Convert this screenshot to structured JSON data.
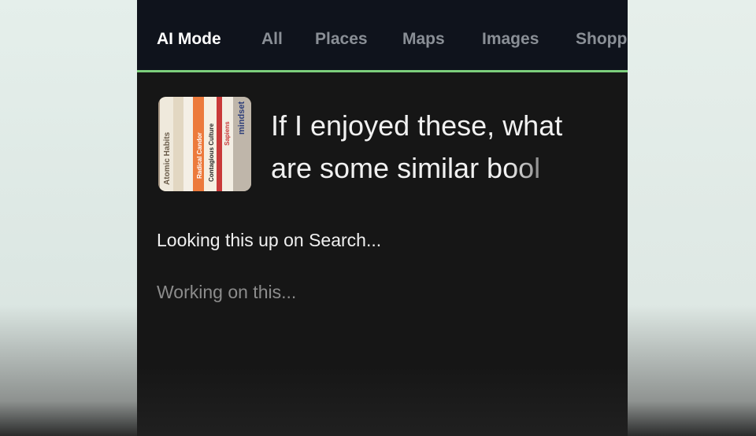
{
  "tabs": [
    {
      "label": "AI Mode",
      "active": true
    },
    {
      "label": "All",
      "active": false
    },
    {
      "label": "Places",
      "active": false
    },
    {
      "label": "Maps",
      "active": false
    },
    {
      "label": "Images",
      "active": false
    },
    {
      "label": "Shopp",
      "active": false
    }
  ],
  "query": {
    "line1": "If I enjoyed these, what",
    "line2": "are some similar bool"
  },
  "thumbnail": {
    "books": [
      "Atomic Habits",
      "",
      "",
      "Radical Candor",
      "Contagious Culture",
      "Sapiens",
      "mindset"
    ]
  },
  "status": {
    "primary": "Looking this up on Search...",
    "secondary": "Working on this..."
  },
  "colors": {
    "accent_underline": "#7ccf7c",
    "tabbar_bg": "#0f131c",
    "phone_bg": "#161616"
  }
}
